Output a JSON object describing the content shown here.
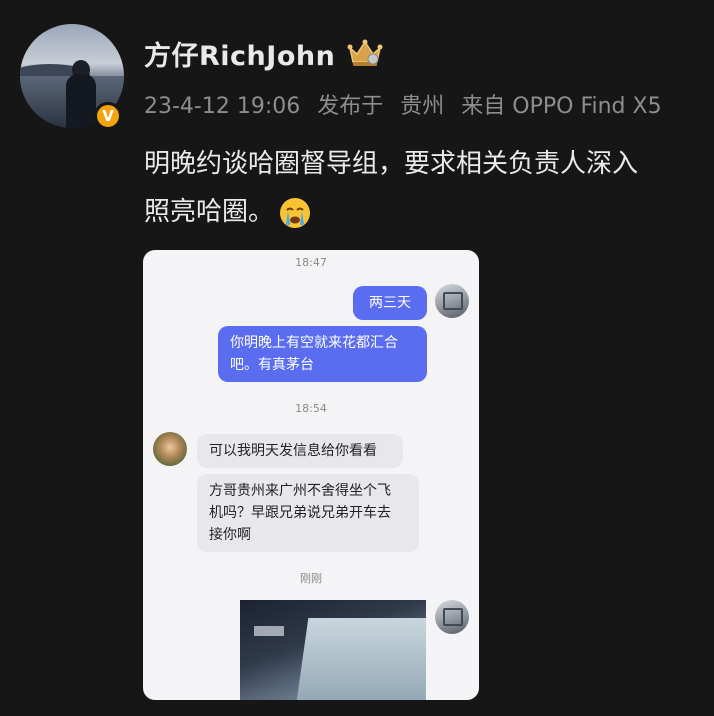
{
  "post": {
    "author": "方仔RichJohn",
    "verified_mark": "V",
    "timestamp": "23-4-12 19:06",
    "published_label": "发布于",
    "location": "贵州",
    "source": "来自 OPPO Find X5",
    "text_line1": "明晚约谈哈圈督导组，要求相关负责人深入",
    "text_line2": "照亮哈圈。",
    "emoji": "crying-face",
    "badge_icon": "crown-badge-icon"
  },
  "chat": {
    "messages": [
      {
        "type": "time",
        "text": "18:47"
      },
      {
        "type": "out",
        "text": "两三天"
      },
      {
        "type": "out",
        "text_line1": "你明晚上有空就来花都汇合",
        "text_line2": "吧。有真茅台"
      },
      {
        "type": "time",
        "text": "18:54"
      },
      {
        "type": "in",
        "text": "可以我明天发信息给你看看"
      },
      {
        "type": "in",
        "text_line1": "方哥贵州来广州不舍得坐个飞",
        "text_line2": "机吗？早跟兄弟说兄弟开车去",
        "text_line3": "接你啊"
      },
      {
        "type": "time",
        "text": "刚刚"
      },
      {
        "type": "out-image",
        "text": ""
      }
    ]
  },
  "colors": {
    "background": "#161616",
    "outgoing_bubble": "#5a6cf0",
    "incoming_bubble": "#e8e8ec",
    "verified_badge": "#f3a411"
  }
}
